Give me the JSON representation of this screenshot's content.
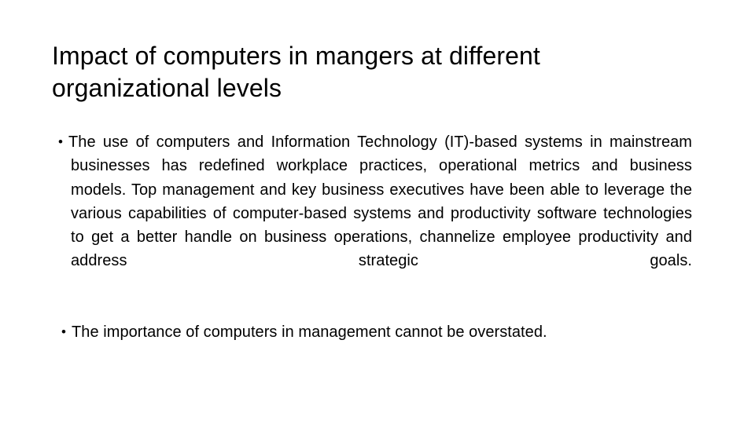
{
  "slide": {
    "background_color": "#ffffff",
    "text_color": "#000000",
    "title": "Impact of computers in mangers at different organizational levels",
    "bullet_marker": "•",
    "bullets": [
      {
        "marker": "•",
        "text": "The use of computers and Information Technology (IT)-based systems in mainstream businesses has redefined workplace practices, operational metrics and business models. Top management and key business executives have been able to leverage the various capabilities of computer-based systems and productivity software technologies to get a better handle on business operations, channelize employee productivity and address strategic goals."
      },
      {
        "marker": "•",
        "text": "The importance of computers in management cannot be overstated."
      }
    ]
  }
}
